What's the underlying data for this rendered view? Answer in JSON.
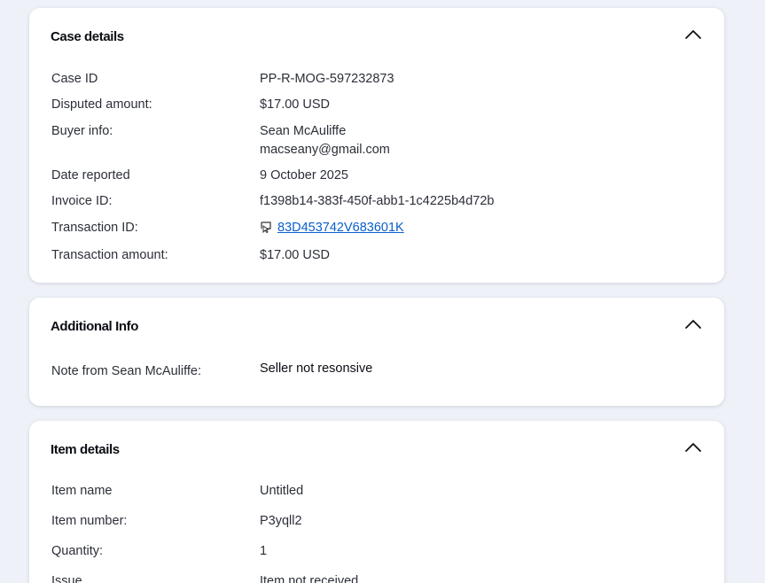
{
  "case_details": {
    "title": "Case details",
    "rows": [
      {
        "label": "Case ID",
        "value": "PP-R-MOG-597232873"
      },
      {
        "label": "Disputed amount:",
        "value": "$17.00 USD"
      },
      {
        "label": "Buyer info:",
        "value": "Sean McAuliffe",
        "value2": "macseany@gmail.com"
      },
      {
        "label": "Date reported",
        "value": "9 October 2025"
      },
      {
        "label": "Invoice ID:",
        "value": "f1398b14-383f-450f-abb1-1c4225b4d72b"
      },
      {
        "label": "Transaction ID:",
        "value": "83D453742V683601K"
      },
      {
        "label": "Transaction amount:",
        "value": "$17.00 USD"
      }
    ]
  },
  "additional_info": {
    "title": "Additional Info",
    "rows": [
      {
        "label": "Note from Sean McAuliffe:",
        "value": "Seller not resonsive"
      }
    ]
  },
  "item_details": {
    "title": "Item details",
    "rows": [
      {
        "label": "Item name",
        "value": "Untitled"
      },
      {
        "label": "Item number:",
        "value": "P3yqll2"
      },
      {
        "label": "Quantity:",
        "value": "1"
      },
      {
        "label": "Issue",
        "value": "Item not received"
      }
    ]
  },
  "colors": {
    "background": "#eef1f7",
    "card": "#ffffff",
    "link": "#0a5fcc"
  },
  "icons": {
    "collapse": "chevron-up-icon",
    "transaction": "transaction-link-icon"
  }
}
